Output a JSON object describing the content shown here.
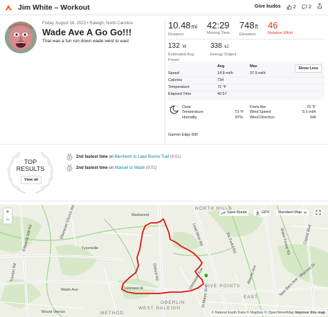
{
  "header": {
    "title": "Jim White – Workout",
    "kudos_label": "Give kudos",
    "kudos_count": "2",
    "comment_count": "2"
  },
  "activity": {
    "date_location": "Friday, August 18, 2023 • Raleigh, North Carolina",
    "name": "Wade Ave A Go Go!!!",
    "description": "That was a fun run down wade west to east"
  },
  "stats": {
    "distance": {
      "value": "10.48",
      "unit": "mi",
      "label": "Distance"
    },
    "moving_time": {
      "value": "42:29",
      "label": "Moving Time"
    },
    "elevation": {
      "value": "748",
      "unit": "ft",
      "label": "Elevation"
    },
    "relative_effort": {
      "value": "46",
      "label": "Relative Effort"
    },
    "power": {
      "value": "132",
      "unit": "W",
      "label_1": "Estimated Avg",
      "label_2": "Power"
    },
    "energy": {
      "value": "338",
      "unit": "kJ",
      "label": "Energy Output"
    }
  },
  "more_stats": {
    "col_avg": "Avg",
    "col_max": "Max",
    "show_less": "Show Less",
    "rows": [
      {
        "label": "Speed",
        "avg": "14.8 mi/h",
        "max": "37.9 mi/h"
      },
      {
        "label": "Calories",
        "avg": "734",
        "max": ""
      },
      {
        "label": "Temperature",
        "avg": "72 °F",
        "max": ""
      },
      {
        "label": "Elapsed Time",
        "avg": "42:57",
        "max": ""
      }
    ]
  },
  "weather": {
    "condition": "Clear",
    "temperature_label": "Temperature",
    "temperature": "73 °F",
    "humidity_label": "Humidity",
    "humidity": "87%",
    "feels_like_label": "Feels like",
    "feels_like": "76 °F",
    "wind_speed_label": "Wind Speed",
    "wind_speed": "5.1 mi/h",
    "wind_direction_label": "Wind Direction",
    "wind_direction": "SW"
  },
  "device": "Garmin Edge 830",
  "results": {
    "top_label_1": "TOP",
    "top_label_2": "RESULTS",
    "view_all": "View all",
    "items": [
      {
        "rank": "2nd fastest time",
        "on": "on",
        "segment": "Blenheim to Lake Boone Trail",
        "time": "(4:01)"
      },
      {
        "rank": "2nd fastest time",
        "on": "on",
        "segment": "Manuel to Wade",
        "time": "(9:01)"
      }
    ]
  },
  "map": {
    "save_route": "Save Route",
    "gpx": "GPX",
    "map_style": "Standard Map",
    "zoom_in": "+",
    "zoom_out": "−",
    "attribution_1": "© Natural Earth Data © Mapbox © OpenStreetMap",
    "attribution_2": "Improve this map",
    "labels": {
      "markwood": "Markwood",
      "tysonville": "Tysonville",
      "north_hills": "NORTH HILLS",
      "west_raleigh": "WEST RALEIGH",
      "oberlin": "OBERLIN",
      "method": "METHOD",
      "five_points": "FIVE POINTS",
      "wade_ave": "Wade Ave",
      "leonard_st": "Leonard St",
      "oxford_rd": "Oxford Rd",
      "mount_vernon": "Mount Vernon",
      "trenton_rd": "Trenton Rd",
      "edwards_mill": "Edwards Mill Rd",
      "ebenezer_church": "Ebenezer Church Rd",
      "lead_mine": "Lead Mine Rd",
      "six_forks": "Six Forks Rd",
      "wake_forest": "Wake Forest Rd",
      "capital_blvd": "Capital Blvd",
      "skycrest": "Skycrest Dr",
      "atlantic_ave": "Atlantic Ave",
      "new_bern": "New Bern Ave",
      "glenwood": "Glenwood Ave",
      "st_marys": "St Marys St",
      "east": "EAST"
    }
  }
}
